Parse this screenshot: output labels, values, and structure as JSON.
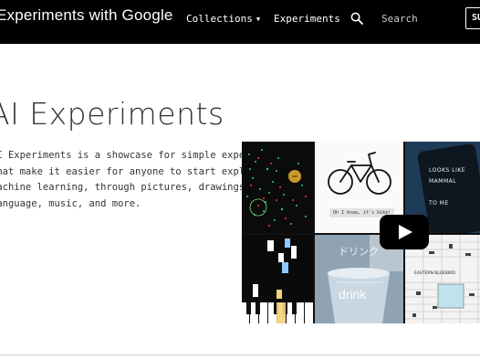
{
  "header": {
    "brand": "Experiments with Google",
    "nav": {
      "collections": "Collections",
      "experiments": "Experiments",
      "search_placeholder": "Search",
      "submit_label": "SUBMIT"
    },
    "icons": [
      "caret-down-icon",
      "search-icon"
    ]
  },
  "hero": {
    "title": "AI Experiments",
    "description": "AI Experiments is a showcase for simple experiments\nthat make it easier for anyone to start exploring\nmachine learning, through pictures, drawings,\nlanguage, music, and more."
  },
  "video": {
    "captions": {
      "bubble": "Oh I know, it's bike!",
      "phone": "LOOKS LIKE\nMAMMAL\n\nTO ME",
      "cup": "drink",
      "katakana": "ドリンク",
      "sheet": "EASTERN BLUEBIRD"
    },
    "play_icon": "play-icon"
  },
  "colors": {
    "header_bg": "#000000",
    "page_bg": "#ffffff",
    "play_button": "#000000"
  }
}
